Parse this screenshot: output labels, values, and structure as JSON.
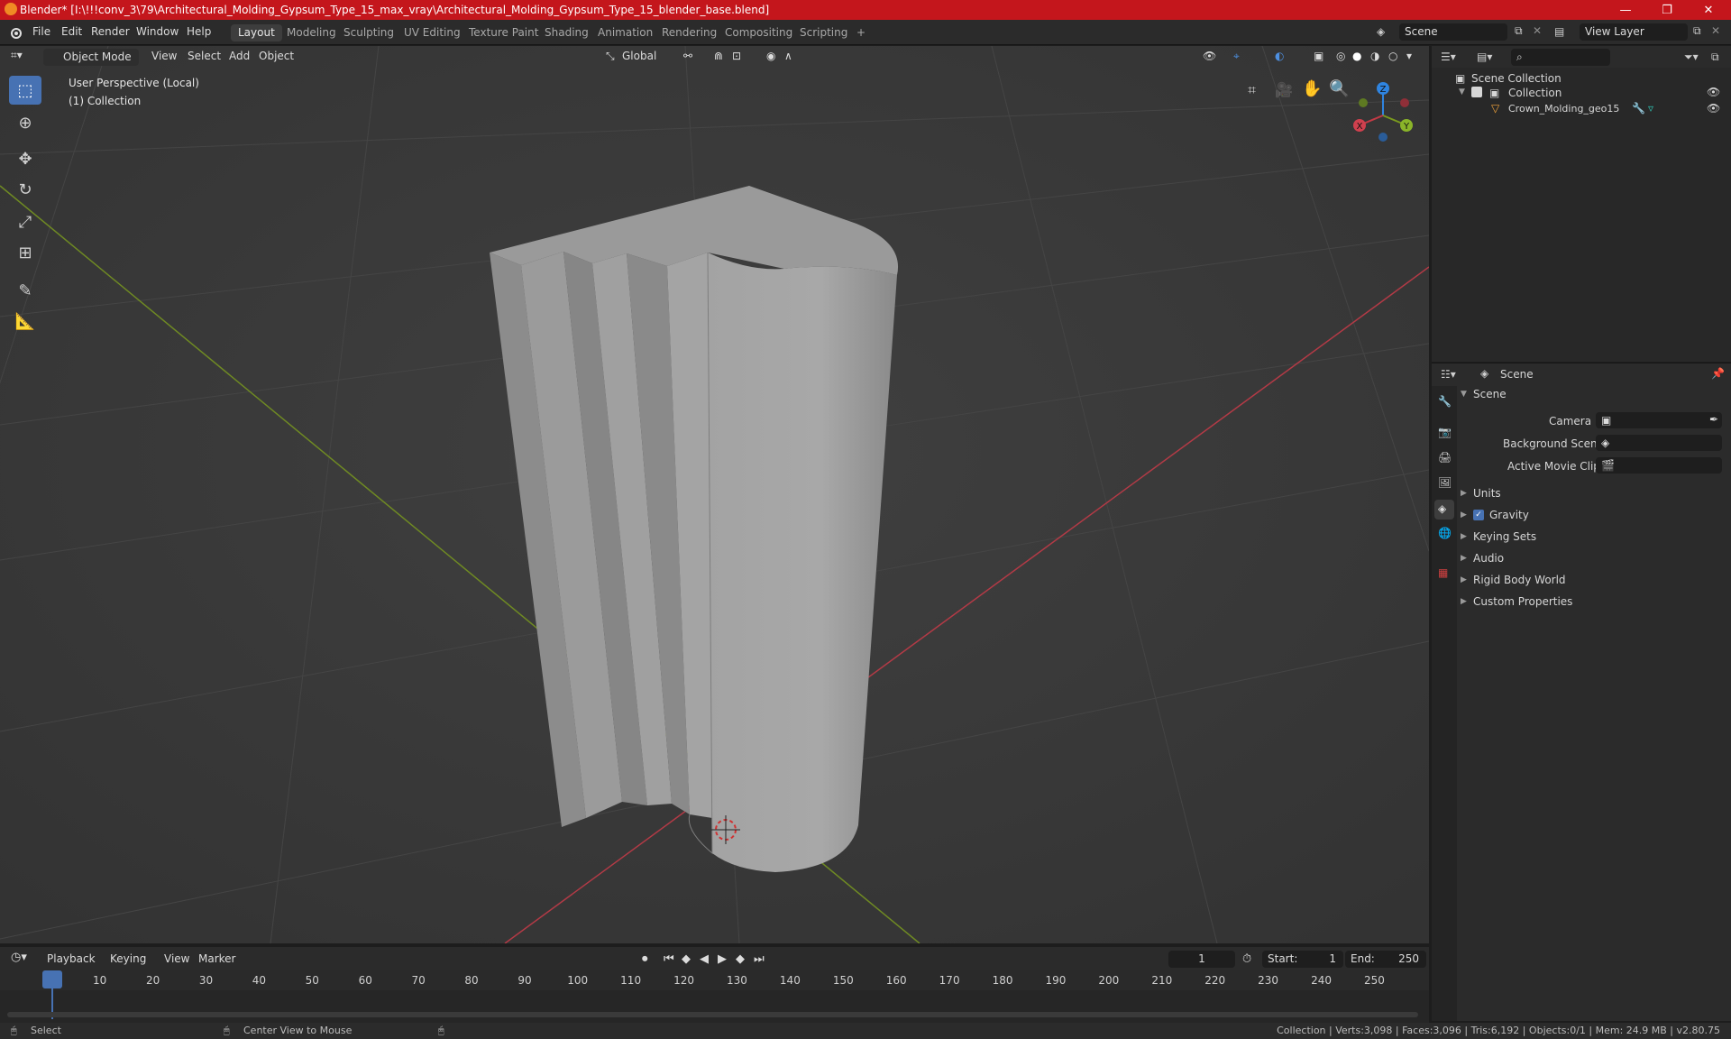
{
  "window": {
    "title": "Blender* [I:\\!!!conv_3\\79\\Architectural_Molding_Gypsum_Type_15_max_vray\\Architectural_Molding_Gypsum_Type_15_blender_base.blend]",
    "minimize": "—",
    "maximize": "❐",
    "close": "✕"
  },
  "menu": [
    "File",
    "Edit",
    "Render",
    "Window",
    "Help"
  ],
  "workspaces": [
    "Layout",
    "Modeling",
    "Sculpting",
    "UV Editing",
    "Texture Paint",
    "Shading",
    "Animation",
    "Rendering",
    "Compositing",
    "Scripting"
  ],
  "workspace_add": "+",
  "scene_field": "Scene",
  "view_layer_field": "View Layer",
  "viewport_header": {
    "mode": "Object Mode",
    "view": "View",
    "select": "Select",
    "add": "Add",
    "object": "Object",
    "orientation": "Global"
  },
  "viewport_overlay": {
    "perspective": "User Perspective (Local)",
    "collection": "(1) Collection"
  },
  "gizmo": {
    "z": "Z",
    "y": "Y",
    "x": "X"
  },
  "outliner": {
    "scene_collection": "Scene Collection",
    "collection": "Collection",
    "object": "Crown_Molding_geo15"
  },
  "properties": {
    "header": "Scene",
    "panel": "Scene",
    "camera_label": "Camera",
    "background_scene_label": "Background Scene",
    "active_movie_clip_label": "Active Movie Clip",
    "sections": [
      "Units",
      "Gravity",
      "Keying Sets",
      "Audio",
      "Rigid Body World",
      "Custom Properties"
    ]
  },
  "timeline": {
    "playback": "Playback",
    "keying": "Keying",
    "view": "View",
    "marker": "Marker",
    "current_frame": "1",
    "start_label": "Start:",
    "start": "1",
    "end_label": "End:",
    "end": "250",
    "ticks": [
      "1",
      "10",
      "20",
      "30",
      "40",
      "50",
      "60",
      "70",
      "80",
      "90",
      "100",
      "110",
      "120",
      "130",
      "140",
      "150",
      "160",
      "170",
      "180",
      "190",
      "200",
      "210",
      "220",
      "230",
      "240",
      "250"
    ]
  },
  "statusbar": {
    "select": "Select",
    "center": "Center View to Mouse",
    "stats": "Collection | Verts:3,098 | Faces:3,096 | Tris:6,192 | Objects:0/1 | Mem: 24.9 MB | v2.80.75"
  },
  "colors": {
    "title_bar": "#c4161c",
    "accent": "#4772b3",
    "x_axis": "#c33a45",
    "y_axis": "#7a9a1e",
    "z_axis": "#2f84e0"
  }
}
